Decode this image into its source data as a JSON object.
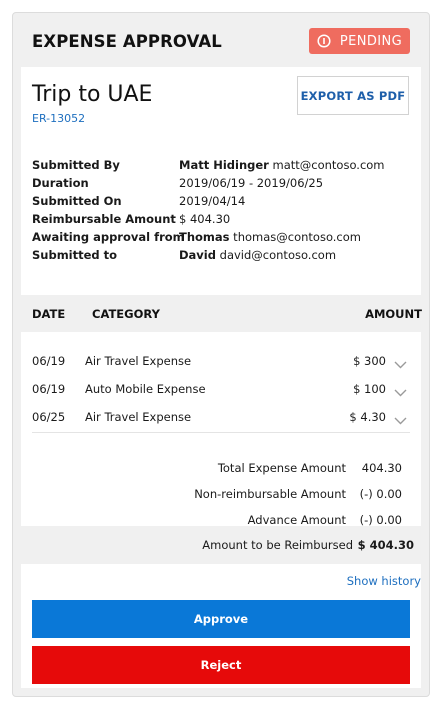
{
  "header": {
    "title": "EXPENSE APPROVAL",
    "status": "PENDING",
    "status_color": "#ef6c5f",
    "status_icon": "info-circle-icon"
  },
  "report": {
    "title": "Trip to UAE",
    "id": "ER-13052",
    "export_label": "EXPORT AS PDF"
  },
  "facts": [
    {
      "label": "Submitted By",
      "value_bold": "Matt Hidinger",
      "value": " matt@contoso.com"
    },
    {
      "label": "Duration",
      "value_bold": "",
      "value": "2019/06/19 - 2019/06/25"
    },
    {
      "label": "Submitted On",
      "value_bold": "",
      "value": "2019/04/14"
    },
    {
      "label": "Reimbursable Amount",
      "value_bold": "",
      "value": "$ 404.30"
    },
    {
      "label": "Awaiting approval from",
      "value_bold": "Thomas",
      "value": " thomas@contoso.com"
    },
    {
      "label": "Submitted to",
      "value_bold": "David",
      "value": " david@contoso.com"
    }
  ],
  "table": {
    "headers": {
      "date": "DATE",
      "category": "CATEGORY",
      "amount": "AMOUNT"
    },
    "rows": [
      {
        "date": "06/19",
        "category": "Air Travel Expense",
        "amount": "$ 300"
      },
      {
        "date": "06/19",
        "category": "Auto Mobile Expense",
        "amount": "$ 100"
      },
      {
        "date": "06/25",
        "category": "Air Travel Expense",
        "amount": "$ 4.30"
      }
    ]
  },
  "totals": [
    {
      "label": "Total Expense Amount",
      "value": "404.30"
    },
    {
      "label": "Non-reimbursable Amount",
      "value": "(-) 0.00"
    },
    {
      "label": "Advance Amount",
      "value": "(-) 0.00"
    }
  ],
  "reimburse": {
    "label": "Amount to be Reimbursed",
    "value": "$ 404.30"
  },
  "actions": {
    "history": "Show history",
    "approve": "Approve",
    "reject": "Reject",
    "approve_color": "#0a78d7",
    "reject_color": "#e60a0a"
  }
}
